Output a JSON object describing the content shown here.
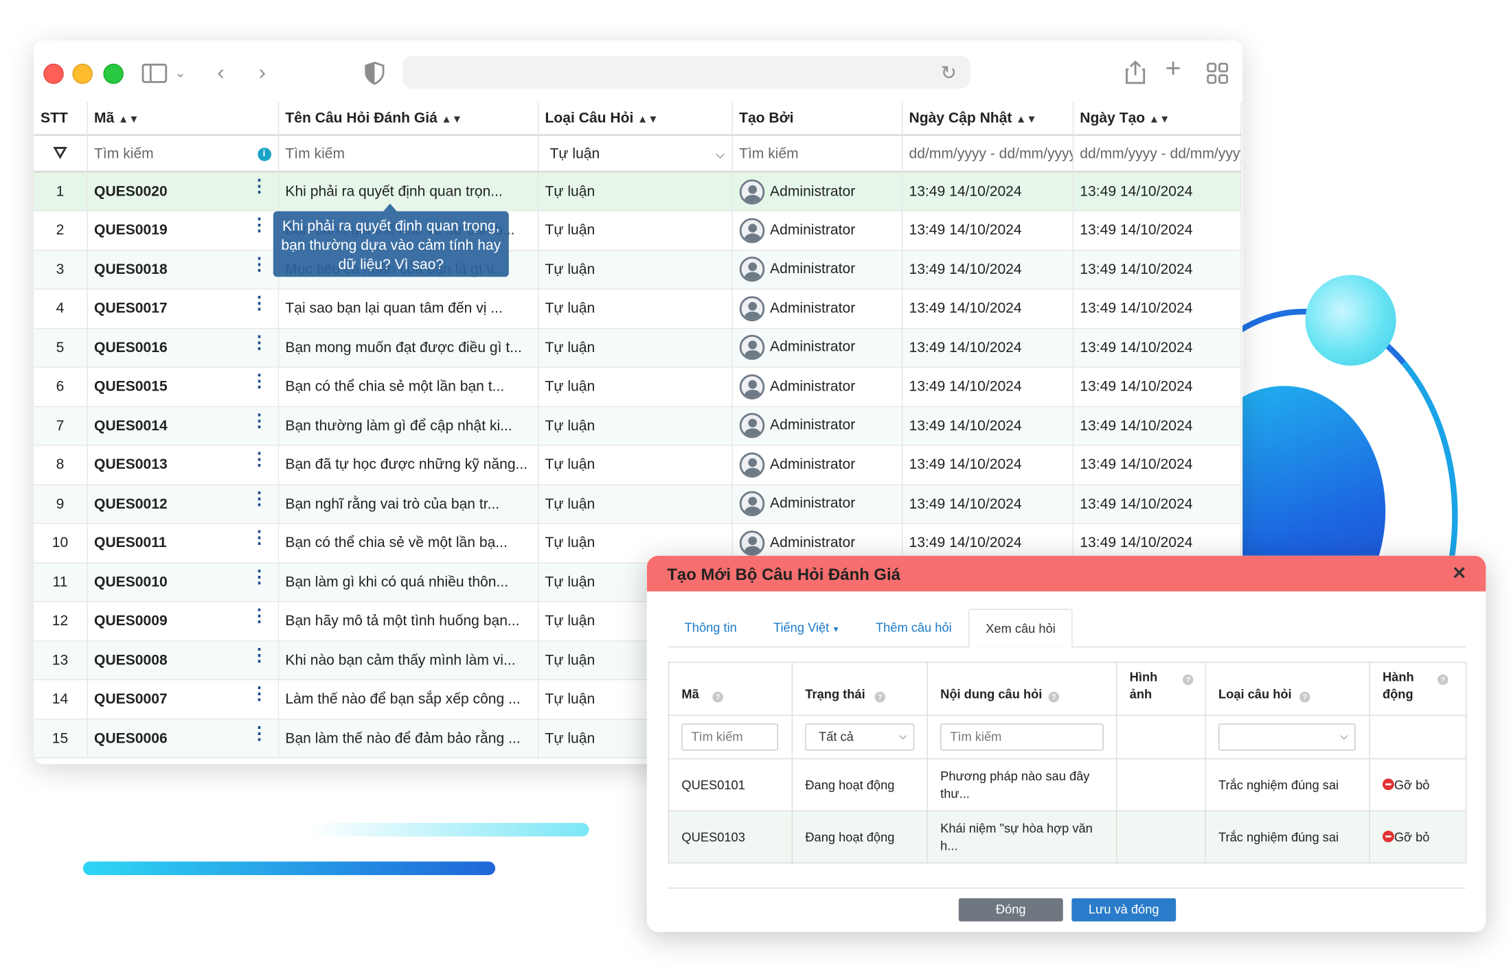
{
  "colors": {
    "accent": "#1f4e8c",
    "modal_header": "#f76e6e",
    "status_active": "#2e9e4b",
    "remove": "#e03333",
    "save_button": "#2a7bc9",
    "close_button": "#6f7780",
    "selected_row": "#e6f7ea"
  },
  "browser": {
    "toolbar": {
      "icons": [
        "sidebar-icon",
        "chevron-down-icon",
        "back-icon",
        "forward-icon",
        "shield-icon",
        "reload-icon",
        "share-icon",
        "plus-icon",
        "tab-overview-icon"
      ]
    }
  },
  "grid": {
    "headers": {
      "stt": "STT",
      "code": "Mã",
      "name": "Tên Câu Hỏi Đánh Giá",
      "type": "Loại Câu Hỏi",
      "creator": "Tạo Bởi",
      "updated": "Ngày Cập Nhật",
      "created": "Ngày Tạo"
    },
    "filters": {
      "code": "Tìm kiếm",
      "name": "Tìm kiếm",
      "type": "Tự luận",
      "creator": "Tìm kiếm",
      "updated": "dd/mm/yyyy - dd/mm/yyyy",
      "created": "dd/mm/yyyy - dd/mm/yyyy"
    },
    "rows": [
      {
        "stt": "1",
        "code": "QUES0020",
        "name": "Khi phải ra quyết định quan trọn...",
        "type": "Tự luận",
        "creator": "Administrator",
        "updated": "13:49 14/10/2024",
        "created": "13:49 14/10/2024"
      },
      {
        "stt": "2",
        "code": "QUES0019",
        "name": "Bạn đánh giá thế nào về sự cân b...",
        "type": "Tự luận",
        "creator": "Administrator",
        "updated": "13:49 14/10/2024",
        "created": "13:49 14/10/2024"
      },
      {
        "stt": "3",
        "code": "QUES0018",
        "name": "Mục tiêu cá nhân của bạn là gì v...",
        "type": "Tự luận",
        "creator": "Administrator",
        "updated": "13:49 14/10/2024",
        "created": "13:49 14/10/2024"
      },
      {
        "stt": "4",
        "code": "QUES0017",
        "name": "Tại sao bạn lại quan tâm đến vị ...",
        "type": "Tự luận",
        "creator": "Administrator",
        "updated": "13:49 14/10/2024",
        "created": "13:49 14/10/2024"
      },
      {
        "stt": "5",
        "code": "QUES0016",
        "name": "Bạn mong muốn đạt được điều gì t...",
        "type": "Tự luận",
        "creator": "Administrator",
        "updated": "13:49 14/10/2024",
        "created": "13:49 14/10/2024"
      },
      {
        "stt": "6",
        "code": "QUES0015",
        "name": "Bạn có thể chia sẻ một lần bạn t...",
        "type": "Tự luận",
        "creator": "Administrator",
        "updated": "13:49 14/10/2024",
        "created": "13:49 14/10/2024"
      },
      {
        "stt": "7",
        "code": "QUES0014",
        "name": "Bạn thường làm gì để cập nhật ki...",
        "type": "Tự luận",
        "creator": "Administrator",
        "updated": "13:49 14/10/2024",
        "created": "13:49 14/10/2024"
      },
      {
        "stt": "8",
        "code": "QUES0013",
        "name": "Bạn đã tự học được những kỹ năng...",
        "type": "Tự luận",
        "creator": "Administrator",
        "updated": "13:49 14/10/2024",
        "created": "13:49 14/10/2024"
      },
      {
        "stt": "9",
        "code": "QUES0012",
        "name": "Bạn nghĩ rằng vai trò của bạn tr...",
        "type": "Tự luận",
        "creator": "Administrator",
        "updated": "13:49 14/10/2024",
        "created": "13:49 14/10/2024"
      },
      {
        "stt": "10",
        "code": "QUES0011",
        "name": "Bạn có thể chia sẻ về một lần bạ...",
        "type": "Tự luận",
        "creator": "Administrator",
        "updated": "13:49 14/10/2024",
        "created": "13:49 14/10/2024"
      },
      {
        "stt": "11",
        "code": "QUES0010",
        "name": "Bạn làm gì khi có quá nhiều thôn...",
        "type": "Tự luận",
        "creator": "",
        "updated": "",
        "created": ""
      },
      {
        "stt": "12",
        "code": "QUES0009",
        "name": "Bạn hãy mô tả một tình huống bạn...",
        "type": "Tự luận",
        "creator": "",
        "updated": "",
        "created": ""
      },
      {
        "stt": "13",
        "code": "QUES0008",
        "name": "Khi nào bạn cảm thấy mình làm vi...",
        "type": "Tự luận",
        "creator": "",
        "updated": "",
        "created": ""
      },
      {
        "stt": "14",
        "code": "QUES0007",
        "name": "Làm thế nào để bạn sắp xếp công ...",
        "type": "Tự luận",
        "creator": "",
        "updated": "",
        "created": ""
      },
      {
        "stt": "15",
        "code": "QUES0006",
        "name": "Bạn làm thế nào để đảm bảo rằng ...",
        "type": "Tự luận",
        "creator": "",
        "updated": "",
        "created": ""
      }
    ],
    "tooltip": "Khi phải ra quyết định quan trọng, bạn thường dựa vào cảm tính hay dữ liệu? Vì sao?"
  },
  "modal": {
    "title": "Tạo Mới Bộ Câu Hỏi Đánh Giá",
    "tabs": {
      "info": "Thông tin",
      "language": "Tiếng Việt",
      "add": "Thêm câu hỏi",
      "view": "Xem câu hỏi"
    },
    "headers": {
      "code": "Mã",
      "status": "Trạng thái",
      "content": "Nội dung câu hỏi",
      "image": "Hình ảnh",
      "type": "Loại câu hỏi",
      "action": "Hành động"
    },
    "filters": {
      "code": "Tìm kiếm",
      "status": "Tất cả",
      "content": "Tìm kiếm",
      "type": ""
    },
    "rows": [
      {
        "code": "QUES0101",
        "status": "Đang hoạt động",
        "content": "Phương pháp nào sau đây thư...",
        "image": "",
        "type": "Trắc nghiệm đúng sai",
        "action": "Gỡ bỏ"
      },
      {
        "code": "QUES0103",
        "status": "Đang hoạt động",
        "content": "Khái niệm \"sự hòa hợp văn h...",
        "image": "",
        "type": "Trắc nghiệm đúng sai",
        "action": "Gỡ bỏ"
      }
    ],
    "buttons": {
      "close": "Đóng",
      "save": "Lưu và đóng"
    }
  }
}
